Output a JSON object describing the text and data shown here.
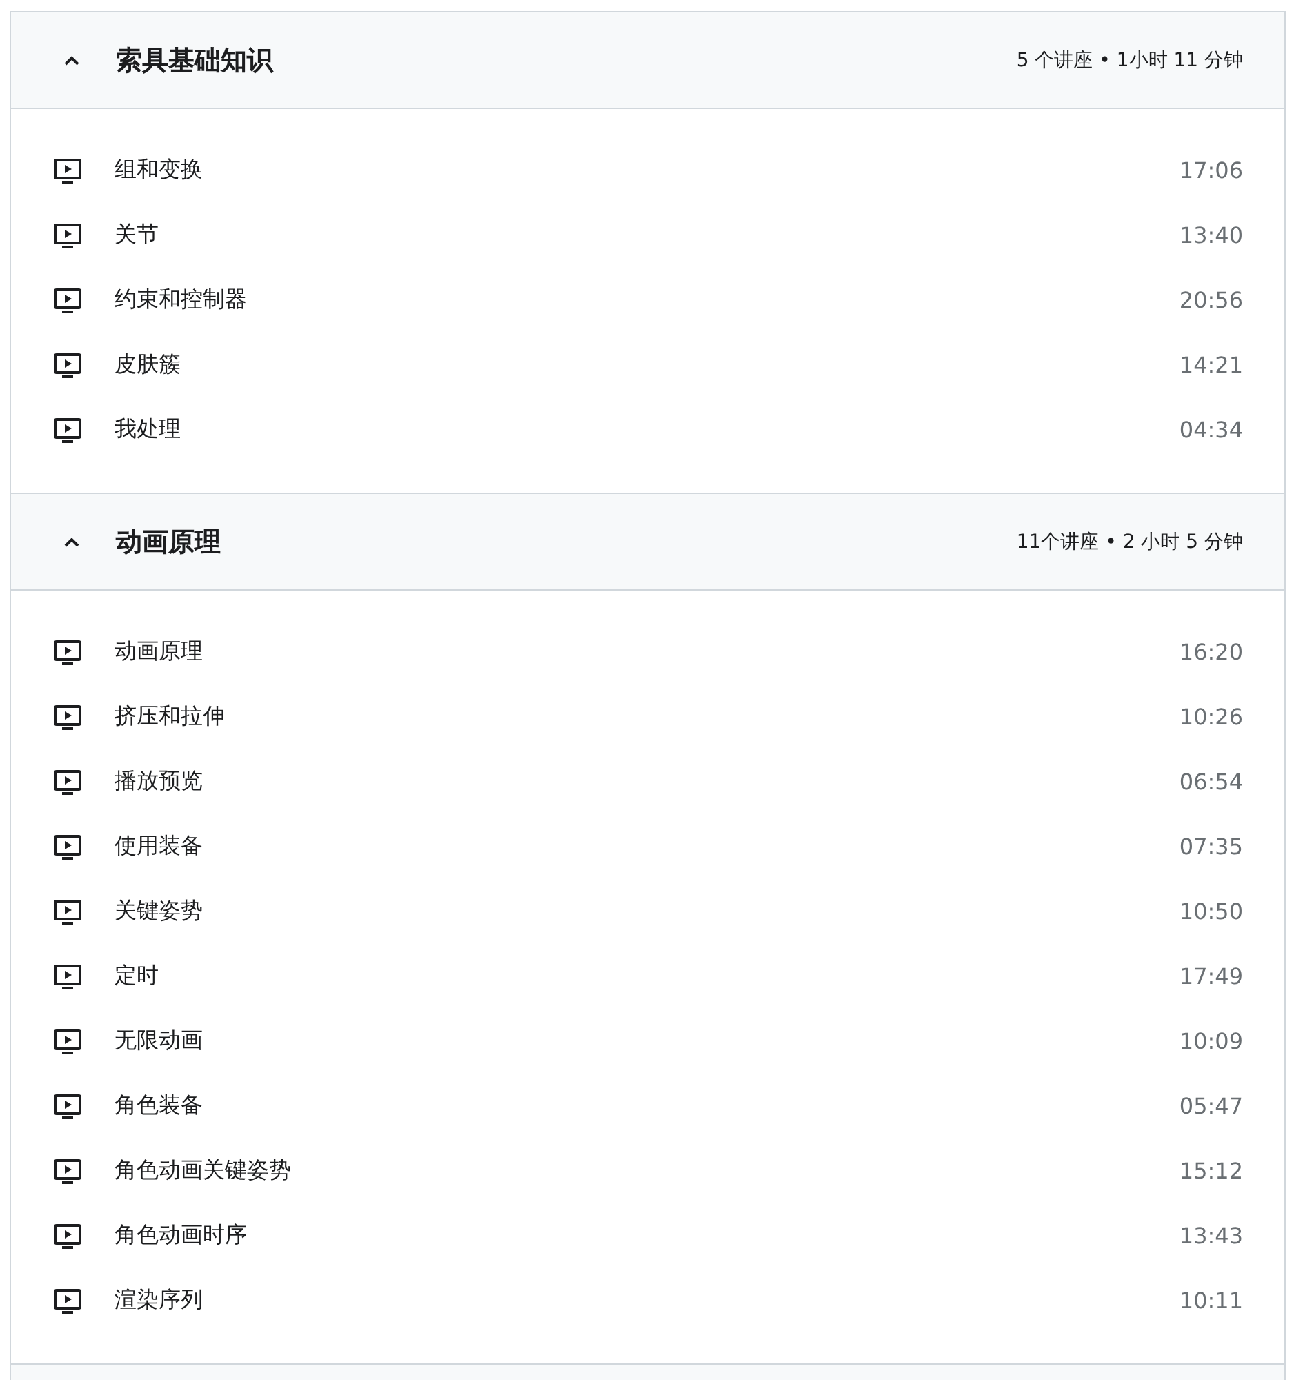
{
  "sections": [
    {
      "title": "索具基础知识",
      "meta": "5 个讲座 • 1小时 11 分钟",
      "expanded": true,
      "lectures": [
        {
          "title": "组和变换",
          "duration": "17:06"
        },
        {
          "title": "关节",
          "duration": "13:40"
        },
        {
          "title": "约束和控制器",
          "duration": "20:56"
        },
        {
          "title": "皮肤簇",
          "duration": "14:21"
        },
        {
          "title": "我处理",
          "duration": "04:34"
        }
      ]
    },
    {
      "title": "动画原理",
      "meta": "11个讲座 • 2 小时 5 分钟",
      "expanded": true,
      "lectures": [
        {
          "title": "动画原理",
          "duration": "16:20"
        },
        {
          "title": "挤压和拉伸",
          "duration": "10:26"
        },
        {
          "title": "播放预览",
          "duration": "06:54"
        },
        {
          "title": "使用装备",
          "duration": "07:35"
        },
        {
          "title": "关键姿势",
          "duration": "10:50"
        },
        {
          "title": "定时",
          "duration": "17:49"
        },
        {
          "title": "无限动画",
          "duration": "10:09"
        },
        {
          "title": "角色装备",
          "duration": "05:47"
        },
        {
          "title": "角色动画关键姿势",
          "duration": "15:12"
        },
        {
          "title": "角色动画时序",
          "duration": "13:43"
        },
        {
          "title": "渲染序列",
          "duration": "10:11"
        }
      ]
    }
  ]
}
